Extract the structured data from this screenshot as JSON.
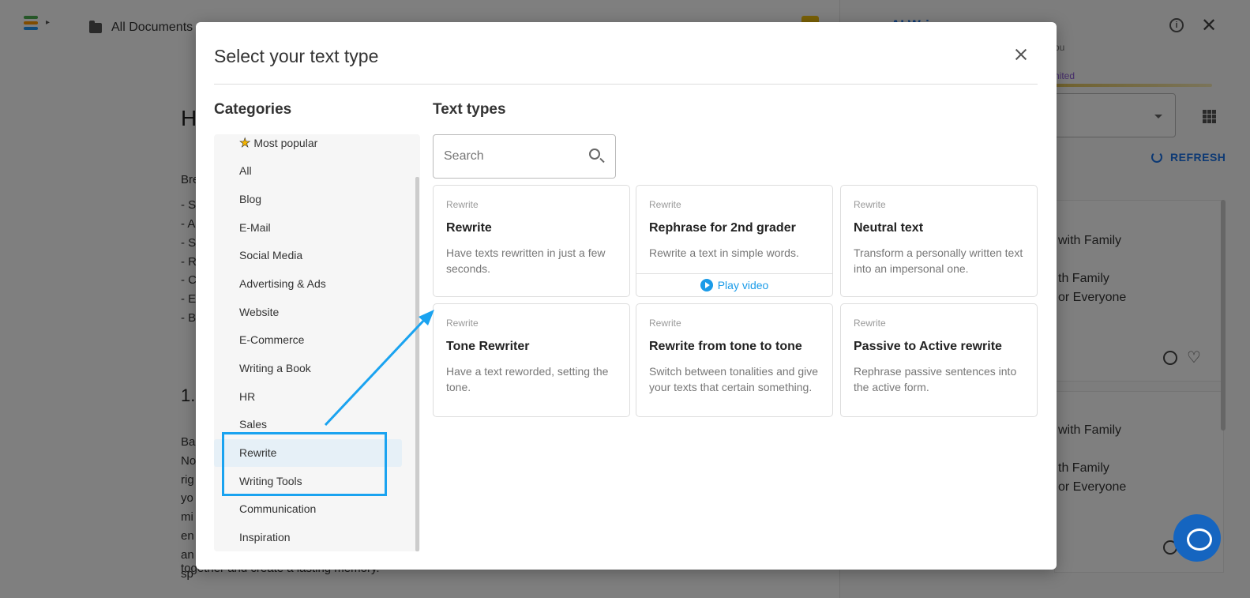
{
  "background": {
    "breadcrumb": "All Documents",
    "doc_heading": "H",
    "doc_lines": [
      "Bre",
      "- S",
      "- A",
      "- S",
      "- R",
      "- C",
      "- E",
      "- B"
    ],
    "doc_section": "1.",
    "doc_para": [
      "Ba",
      "No",
      "rig",
      "yo",
      "mi",
      "en",
      "an",
      "sp"
    ],
    "doc_tail": "together and create a lasting memory.",
    "right_panel": {
      "title": "AI Wri",
      "you": "ou",
      "limited": "nited",
      "refresh_label": "REFRESH",
      "card1": [
        "with Family",
        "th Family",
        "or Everyone"
      ],
      "card2": [
        "with Family",
        "th Family",
        "or Everyone"
      ]
    }
  },
  "modal": {
    "title": "Select your text type",
    "categories_heading": "Categories",
    "text_types_heading": "Text types",
    "search_placeholder": "Search",
    "categories": [
      {
        "label": "Most popular",
        "icon": "star-icon"
      },
      {
        "label": "All"
      },
      {
        "label": "Blog"
      },
      {
        "label": "E-Mail"
      },
      {
        "label": "Social Media"
      },
      {
        "label": "Advertising & Ads"
      },
      {
        "label": "Website"
      },
      {
        "label": "E-Commerce"
      },
      {
        "label": "Writing a Book"
      },
      {
        "label": "HR"
      },
      {
        "label": "Sales"
      },
      {
        "label": "Rewrite",
        "active": true
      },
      {
        "label": "Writing Tools"
      },
      {
        "label": "Communication"
      },
      {
        "label": "Inspiration"
      }
    ],
    "cards": [
      {
        "category": "Rewrite",
        "title": "Rewrite",
        "desc": "Have texts rewritten in just a few seconds."
      },
      {
        "category": "Rewrite",
        "title": "Rephrase for 2nd grader",
        "desc": "Rewrite a text in simple words.",
        "play_label": "Play video"
      },
      {
        "category": "Rewrite",
        "title": "Neutral text",
        "desc": "Transform a personally written text into an impersonal one."
      },
      {
        "category": "Rewrite",
        "title": "Tone Rewriter",
        "desc": "Have a text reworded, setting the tone."
      },
      {
        "category": "Rewrite",
        "title": "Rewrite from tone to tone",
        "desc": "Switch between tonalities and give your texts that certain something."
      },
      {
        "category": "Rewrite",
        "title": "Passive to Active rewrite",
        "desc": "Rephrase passive sentences into the active form."
      }
    ]
  },
  "colors": {
    "accent": "#1a9be8",
    "annotation": "#1aa3f0",
    "active_category_bg": "#e6f0f7"
  }
}
